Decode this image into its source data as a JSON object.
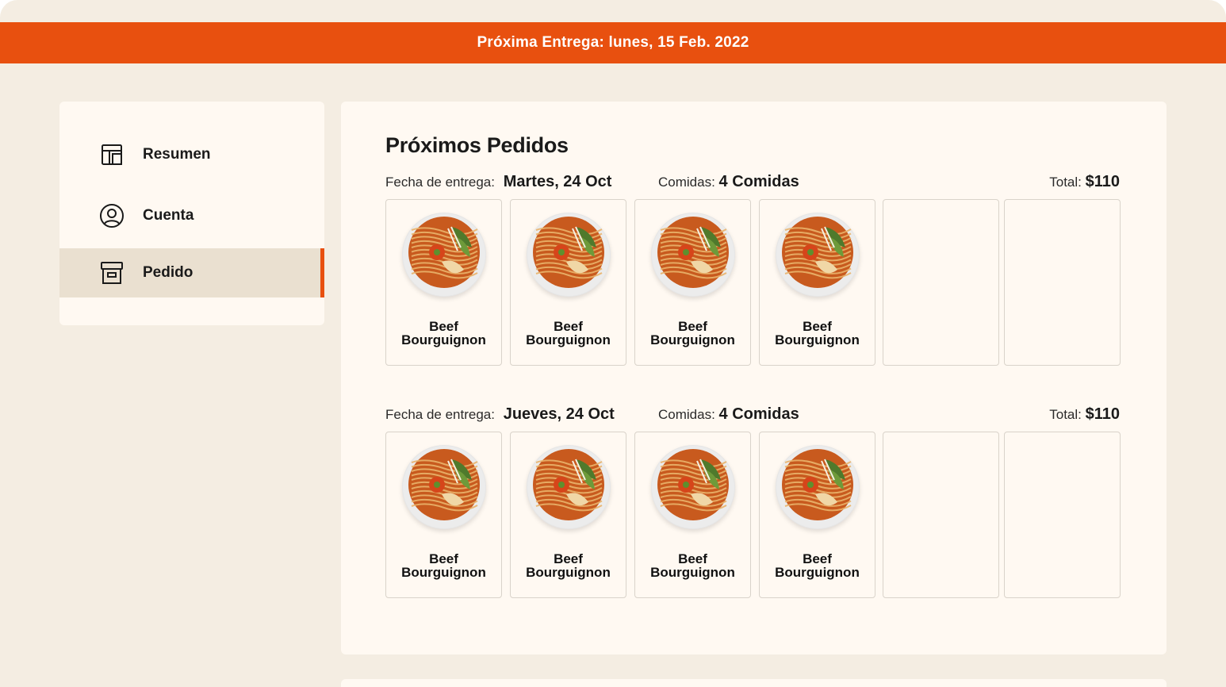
{
  "banner": {
    "text": "Próxima Entrega: lunes, 15 Feb. 2022"
  },
  "sidebar": {
    "items": [
      {
        "label": "Resumen",
        "icon": "layout-icon",
        "active": false
      },
      {
        "label": "Cuenta",
        "icon": "user-circle-icon",
        "active": false
      },
      {
        "label": "Pedido",
        "icon": "archive-box-icon",
        "active": true
      }
    ]
  },
  "main": {
    "title": "Próximos Pedidos",
    "orders": [
      {
        "date_label": "Fecha de entrega:",
        "date_value": "Martes, 24 Oct",
        "meals_label": "Comidas:",
        "meals_value": "4 Comidas",
        "total_label": "Total:",
        "total_value": "$110",
        "items": [
          {
            "name_line1": "Beef",
            "name_line2": "Bourguignon"
          },
          {
            "name_line1": "Beef",
            "name_line2": "Bourguignon"
          },
          {
            "name_line1": "Beef",
            "name_line2": "Bourguignon"
          },
          {
            "name_line1": "Beef",
            "name_line2": "Bourguignon"
          }
        ],
        "empty_slots": 2
      },
      {
        "date_label": "Fecha de entrega:",
        "date_value": "Jueves, 24 Oct",
        "meals_label": "Comidas:",
        "meals_value": "4 Comidas",
        "total_label": "Total:",
        "total_value": "$110",
        "items": [
          {
            "name_line1": "Beef",
            "name_line2": "Bourguignon"
          },
          {
            "name_line1": "Beef",
            "name_line2": "Bourguignon"
          },
          {
            "name_line1": "Beef",
            "name_line2": "Bourguignon"
          },
          {
            "name_line1": "Beef",
            "name_line2": "Bourguignon"
          }
        ],
        "empty_slots": 2
      }
    ]
  },
  "colors": {
    "accent": "#e8500f",
    "page_bg": "#f4ede2",
    "panel_bg": "#fff9f2",
    "active_bg": "#eae0d0"
  }
}
